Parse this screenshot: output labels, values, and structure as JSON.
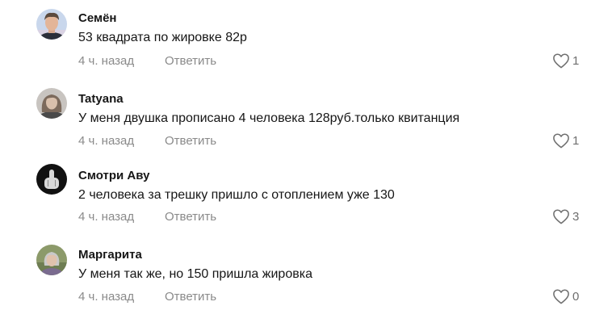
{
  "comments": [
    {
      "author": "Семён",
      "text": "53 квадрата по жировке 82р",
      "time": "4 ч. назад",
      "reply": "Ответить",
      "likes": "1"
    },
    {
      "author": "Tatyana",
      "text": "У меня двушка прописано 4 человека 128руб.только квитанция",
      "time": "4 ч. назад",
      "reply": "Ответить",
      "likes": "1"
    },
    {
      "author": "Смотри Аву",
      "text": "2 человека за трешку пришло с отоплением уже 130",
      "time": "4 ч. назад",
      "reply": "Ответить",
      "likes": "3"
    },
    {
      "author": "Маргарита",
      "text": "У меня так же, но 150 пришла жировка",
      "time": "4 ч. назад",
      "reply": "Ответить",
      "likes": "0"
    }
  ],
  "icons": {
    "like": "heart-outline-icon"
  },
  "colors": {
    "muted_text": "#8a8a8a",
    "primary_text": "#161616"
  }
}
